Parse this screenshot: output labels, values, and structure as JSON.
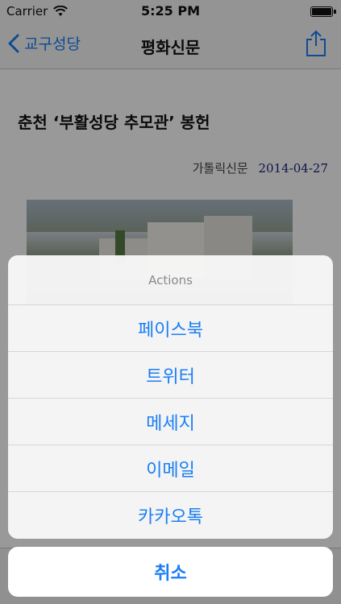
{
  "status_bar": {
    "carrier": "Carrier",
    "time": "5:25 PM"
  },
  "nav": {
    "back_label": "교구성당",
    "title": "평화신문"
  },
  "article": {
    "title": "춘천 ‘부활성당 추모관’ 봉헌",
    "source": "가톨릭신문",
    "date": "2014-04-27"
  },
  "action_sheet": {
    "header": "Actions",
    "actions": [
      {
        "label": "페이스북"
      },
      {
        "label": "트위터"
      },
      {
        "label": "메세지"
      },
      {
        "label": "이메일"
      },
      {
        "label": "카카오톡"
      }
    ],
    "cancel_label": "취소"
  },
  "colors": {
    "accent": "#1a7ef5",
    "date_color": "#1a237e"
  }
}
